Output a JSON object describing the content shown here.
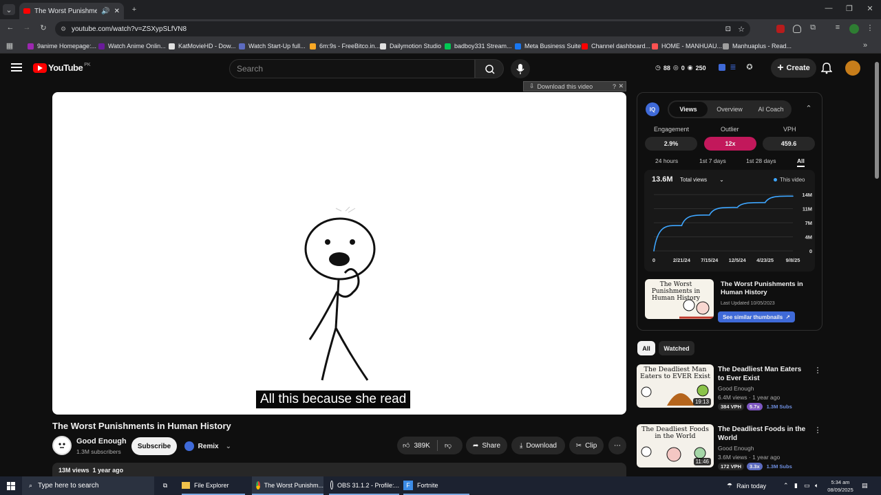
{
  "browser": {
    "tab_title": "The Worst Punishments in H",
    "url": "youtube.com/watch?v=ZSXypSLfVN8",
    "bookmarks": [
      {
        "label": "9anime Homepage:...",
        "color": "#9c27b0"
      },
      {
        "label": "Watch Anime Onlin...",
        "color": "#6a1b9a"
      },
      {
        "label": "KatMovieHD - Dow...",
        "color": "#e0e0e0"
      },
      {
        "label": "Watch Start-Up full...",
        "color": "#5c6bc0"
      },
      {
        "label": "6m:9s - FreeBitco.in...",
        "color": "#f9a825"
      },
      {
        "label": "Dailymotion Studio",
        "color": "#e0e0e0"
      },
      {
        "label": "badboy331 Stream...",
        "color": "#00c853"
      },
      {
        "label": "Meta Business Suite",
        "color": "#1877f2"
      },
      {
        "label": "Channel dashboard...",
        "color": "#ff0000"
      },
      {
        "label": "HOME - MANHUAU...",
        "color": "#ff5252"
      },
      {
        "label": "Manhuaplus - Read...",
        "color": "#9e9e9e"
      }
    ]
  },
  "youtube": {
    "logo": "YouTube",
    "region": "PK",
    "search_placeholder": "Search",
    "stats": {
      "a": "88",
      "b": "0",
      "c": "250"
    },
    "create_label": "Create",
    "download_bar": "Download this video"
  },
  "video": {
    "caption": "All this because she read",
    "title": "The Worst Punishments in Human History",
    "channel": "Good Enough",
    "subscribers": "1.3M subscribers",
    "subscribe_label": "Subscribe",
    "remix_label": "Remix",
    "likes": "389K",
    "share_label": "Share",
    "download_label": "Download",
    "clip_label": "Clip",
    "views": "13M views",
    "age": "1 year ago"
  },
  "vidiq": {
    "tabs": [
      "Views",
      "Overview",
      "AI Coach"
    ],
    "metrics": [
      {
        "label": "Engagement",
        "value": "2.9%"
      },
      {
        "label": "Outlier",
        "value": "12x"
      },
      {
        "label": "VPH",
        "value": "459.6"
      }
    ],
    "ranges": [
      "24 hours",
      "1st 7 days",
      "1st 28 days",
      "All"
    ],
    "total": "13.6M",
    "total_label": "Total views",
    "legend": "This video",
    "thumb_text": "The Worst Punishments in Human History",
    "video_title": "The Worst Punishments in Human History",
    "last_updated": "Last Updated 10/05/2023",
    "similar_label": "See similar thumbnails"
  },
  "chart_data": {
    "type": "line",
    "x": [
      "0",
      "2/21/24",
      "7/15/24",
      "12/5/24",
      "4/23/25",
      "9/8/25"
    ],
    "y": [
      0,
      6.3,
      8.9,
      10.8,
      12.0,
      13.6
    ],
    "ylim": [
      0,
      14
    ],
    "yticks": [
      "0",
      "4M",
      "7M",
      "11M",
      "14M"
    ],
    "series": [
      {
        "name": "This video"
      }
    ],
    "color": "#3ea6ff"
  },
  "filters": [
    "All",
    "Watched"
  ],
  "recommendations": [
    {
      "title": "The Deadliest Man Eaters to Ever Exist",
      "thumb_text": "The Deadliest Man Eaters to EVER Exist",
      "channel": "Good Enough",
      "meta": "6.4M views · 1 year ago",
      "duration": "19:13",
      "vph": "384 VPH",
      "mult": "5.7x",
      "subs": "1.3M Subs",
      "mult_color": "#7e57c2"
    },
    {
      "title": "The Deadliest Foods in the World",
      "thumb_text": "The Deadliest Foods in the World",
      "channel": "Good Enough",
      "meta": "3.6M views · 1 year ago",
      "duration": "11:46",
      "vph": "172 VPH",
      "mult": "3.3x",
      "subs": "1.3M Subs",
      "mult_color": "#5c6bc0"
    }
  ],
  "taskbar": {
    "search_placeholder": "Type here to search",
    "apps": [
      "File Explorer",
      "The Worst Punishm...",
      "OBS 31.1.2 - Profile:...",
      "Fortnite"
    ],
    "weather": "Rain today",
    "time": "5:34 am",
    "date": "08/09/2025"
  }
}
